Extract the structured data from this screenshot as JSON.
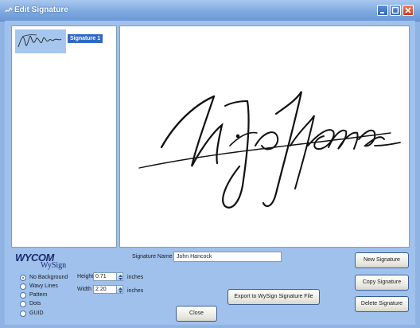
{
  "window": {
    "title": "Edit Signature"
  },
  "list": {
    "items": [
      {
        "label": "Signature 1",
        "selected": true
      }
    ]
  },
  "logo": {
    "brand": "WYCOM",
    "product": "WySign"
  },
  "background_options": [
    {
      "label": "No Background",
      "checked": true
    },
    {
      "label": "Wavy Lines",
      "checked": false
    },
    {
      "label": "Pattern",
      "checked": false
    },
    {
      "label": "Dots",
      "checked": false
    },
    {
      "label": "GUID",
      "checked": false
    }
  ],
  "size": {
    "height_label": "Height",
    "height_value": "0.71",
    "width_label": "Width",
    "width_value": "2.20",
    "unit": "inches"
  },
  "signature_name": {
    "label": "Signature Name",
    "value": "John Hancock"
  },
  "buttons": {
    "export": "Export to WySign Signature File",
    "close": "Close",
    "new": "New Signature",
    "copy": "Copy Signature",
    "delete": "Delete Signature"
  },
  "colors": {
    "window_bg": "#9fc1ec",
    "selection": "#3167c6",
    "close_button": "#c8391b"
  }
}
